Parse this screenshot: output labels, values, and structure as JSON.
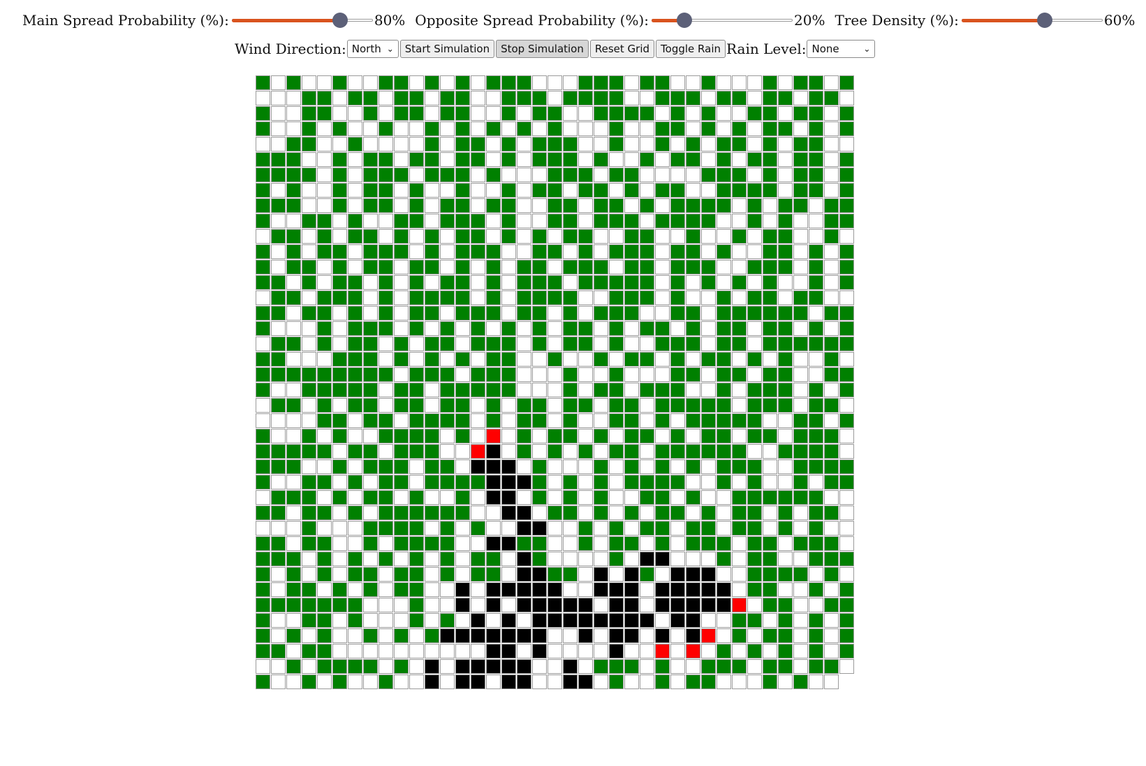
{
  "controls": {
    "main_spread": {
      "label": "Main Spread Probability (%):",
      "value": 80,
      "value_text": "80%"
    },
    "opposite_spread": {
      "label": "Opposite Spread Probability (%):",
      "value": 20,
      "value_text": "20%"
    },
    "tree_density": {
      "label": "Tree Density (%):",
      "value": 60,
      "value_text": "60%"
    },
    "wind": {
      "label": "Wind Direction:",
      "selected": "North"
    },
    "buttons": {
      "start": "Start Simulation",
      "stop": "Stop Simulation",
      "reset": "Reset Grid",
      "rain": "Toggle Rain"
    },
    "rain_level": {
      "label": "Rain Level:",
      "selected": "None"
    }
  },
  "colors": {
    "tree": "#008000",
    "burnt": "#000000",
    "fire": "#ff0000",
    "empty": "#ffffff",
    "slider_fill": "#d9531e",
    "slider_thumb": "#5c6078"
  },
  "grid": {
    "legend": {
      "T": "tree",
      ".": "empty",
      "B": "burnt",
      "F": "fire"
    },
    "rows": [
      "T.T..T..TT.T.T.TTT...TTT.TT..T...T.TT.T",
      "...TT.TT.TT.TT..TTT.TTTT..TTT.TT.TT.TT.",
      "T..TT..T.TT.TT..T.TT..TTTT.T.T..TT.TT.T",
      "T..T.T..T..T.T.T.T.T...T..TT.T.T.TT.T.T",
      "..TT..T....T.TT.T.TTT..T..T.T.TT.T.TT..",
      "TTT..T.TT.TT.TT.T.TTT.T..T.TT.T.TT.TT.T",
      "TTTT.T.TTT.TTT.T...TTT.TT....TTT.T.TT.T",
      "T.T..T.TT.T..T..T.TT.TT.T.TT..TTTT.TT.T",
      "TTT..T.TT.T.TT.TT..TT.TT.T.TTTT.T.TT.TT",
      "T..TT.T..TT.TTT.T..TT.TTT.TTTT..T.T..TT",
      ".TT.T.TT.T.T.TT.T.T.TT..TT..T..T.TT..T.",
      "T.T.TT.TTT.T.TTT..TT.T.TTT.TT.T..TT.T.T",
      "T.TT.T.TT.TT.T.T.TT.TTT.TT.TTT..TTT.T.T",
      "TT.T.TT.T.T.TT.T.TTT.TTTTT.T.T.T.T..T.T",
      ".TT.TTT.T.TTTT.T.TTTT..TTT.T..T.TT.TT..",
      "TT.TT.T.T.TT.TTT.TT.T.TTT..TT.TTTTTT.TT",
      "T...T.TTT.T.T.T.T.T.TT.T.TT.T.TT.TT.T.T",
      ".TT.T.TT.T.TT.TTT.T.TT.T..TTT.TT.TTTTTT",
      "TT...TTT.T.T.T.TT..T..T.TT.T.TT.T.T..T.",
      "TTTTTTTTT.TTT.TTT...T..T...TT.TT.TT..TT",
      "T..TTTTT.TT.TTTTT...T.TT.TTT..T.TTT.T.T",
      ".TT.T.TT.TT.TT.T.TT.TT.TT.TTTTT.TTT.TT.",
      "....TT.TT.TTTT.T.TT.T..TT.T.TTTTT..TT.T",
      "T..T.T..TTTT.T.F.T.TT.T.TT.T.TT.TT.TTT.",
      "TTTTT.TT.TTT..FB.T.T.T.TT.TTTTTT..TTTT.",
      "TTT..T.TTT.TT.BBB.T...T.T.T.T.TTT..TTTT",
      "T..TT.T.TT.TTTTBBBT.T.T.TTTT..T.T..T.TT",
      ".TTT.T.TT.T..T.BB.T.T.T..TT.T..TTTTTT..",
      "TT.TT.T.TTTTTT..BB.TT.T.T.TT.T.TT.T.TT.",
      "...T...TTTT.T.T..BB..T.T.TT.TT.TT.T.T..",
      "TT.TT..T.TTTT..BBTT..T.TT.T.TTT.TT.TTT.",
      "TTT.T.T.T.T.T.TT.BT....T.BB...T.TT..TTT",
      "T.T.T.TT.TT.T.TT.BBTT.B.BT.BBB..TTTT.T.",
      "T.TT.T.T.TT..B.BBBBB..BBB.BBBBB.TT..T.T",
      "TTTTTTT...T..B.B.BBBBB.BB.BBBBBF.TT..TT",
      "T..TT.T...T.T.B.B.BBBBBBBB.BB..TT.T.T.T",
      "T.T.T..T.T.TBBBBBBB..B.BB.B.BF.T.TT.T.T",
      "TT.TT..........BB.B....B..F.F.T.T.T.T.",
      "T..T.TTTT.T.B.BBBBB..B.TTT.T..TTT.TT.TT",
      ".T..T.T..T..B.BB.BB..BB.T..T.TT...T.T.."
    ]
  }
}
